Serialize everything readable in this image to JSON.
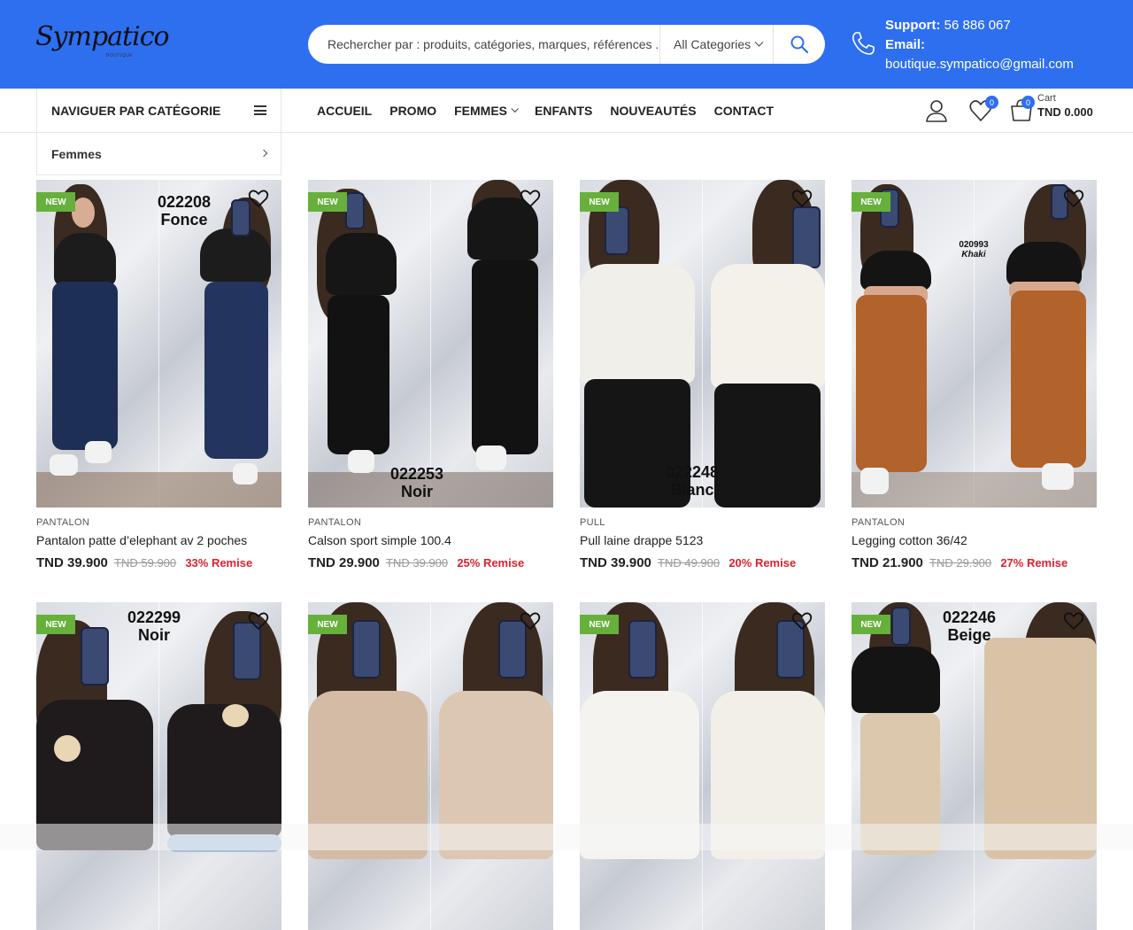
{
  "header": {
    "logo_text": "Sympatico",
    "logo_sub": "BOUTIQUE",
    "search_placeholder": "Rechercher par : produits, catégories, marques, références ...",
    "category_select": "All Categories",
    "support_label": "Support:",
    "support_phone": "56 886 067",
    "email_label": "Email:",
    "email": "boutique.sympatico@gmail.com"
  },
  "nav": {
    "category_toggle": "NAVIGUER PAR CATÉGORIE",
    "items": [
      "ACCUEIL",
      "PROMO",
      "FEMMES",
      "ENFANTS",
      "NOUVEAUTÉS",
      "CONTACT"
    ],
    "wishlist_count": "0",
    "cart_count": "0",
    "cart_label": "Cart",
    "cart_total": "TND 0.000"
  },
  "category_dropdown": {
    "items": [
      "Femmes"
    ]
  },
  "products": [
    {
      "badge": "NEW",
      "code": "022208",
      "code2": "Fonce",
      "category": "PANTALON",
      "title": "Pantalon patte d’elephant av 2 poches",
      "price": "TND 39.900",
      "old_price": "TND 59.900",
      "discount": "33% Remise"
    },
    {
      "badge": "NEW",
      "code": "022253",
      "code2": "Noir",
      "category": "PANTALON",
      "title": "Calson sport simple 100.4",
      "price": "TND 29.900",
      "old_price": "TND 39.900",
      "discount": "25% Remise"
    },
    {
      "badge": "NEW",
      "code": "022248",
      "code2": "Blanc",
      "category": "PULL",
      "title": "Pull laine drappe 5123",
      "price": "TND 39.900",
      "old_price": "TND 49.900",
      "discount": "20% Remise"
    },
    {
      "badge": "NEW",
      "code": "020993",
      "code2": "Khaki",
      "category": "PANTALON",
      "title": "Legging cotton 36/42",
      "price": "TND 21.900",
      "old_price": "TND 29.900",
      "discount": "27% Remise"
    },
    {
      "badge": "NEW",
      "code": "022299",
      "code2": "Noir"
    },
    {
      "badge": "NEW"
    },
    {
      "badge": "NEW"
    },
    {
      "badge": "NEW",
      "code": "022246",
      "code2": "Beige"
    }
  ],
  "colors": {
    "brand_blue": "#2e6ff0",
    "new_badge": "#67b03b",
    "discount_red": "#d9232d"
  },
  "icons": [
    "phone-icon",
    "search-icon",
    "menu-icon",
    "chevron-down-icon",
    "chevron-right-icon",
    "user-icon",
    "heart-icon",
    "cart-icon"
  ]
}
